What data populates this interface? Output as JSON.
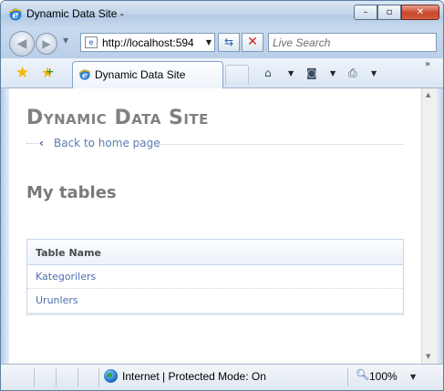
{
  "window": {
    "title": "Dynamic Data Site -",
    "minimize_glyph": "–",
    "maximize_glyph": "▫",
    "close_glyph": "✕"
  },
  "navbar": {
    "address": "http://localhost:594",
    "search_placeholder": "Live Search"
  },
  "tabbar": {
    "tab_label": "Dynamic Data Site"
  },
  "page": {
    "site_title": "Dynamic Data Site",
    "back_link": "Back to home page",
    "heading": "My tables",
    "table": {
      "columns": [
        "Table Name"
      ],
      "rows": [
        "Kategorilers",
        "Urunlers"
      ]
    }
  },
  "statusbar": {
    "zone": "Internet | Protected Mode: On",
    "zoom": "100%"
  },
  "colors": {
    "title_gray": "#808080",
    "link_blue": "#4d6fae",
    "chrome_blue": "#c3d6ea"
  },
  "icons": [
    "ie-icon",
    "back-icon",
    "forward-icon",
    "refresh-icon",
    "stop-icon",
    "favorites-star-icon",
    "add-favorites-icon",
    "home-icon",
    "feeds-icon",
    "print-icon",
    "globe-icon",
    "zoom-icon"
  ]
}
